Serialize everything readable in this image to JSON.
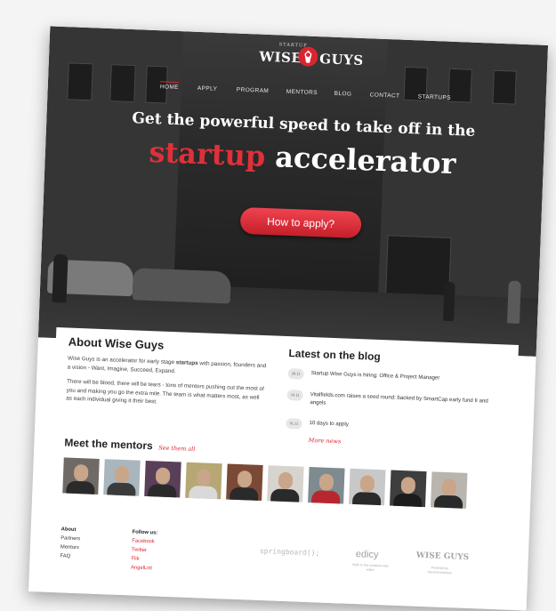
{
  "logo": {
    "small": "STARTUP",
    "left": "WISE",
    "right": "GUYS"
  },
  "nav": {
    "items": [
      "HOME",
      "APPLY",
      "PROGRAM",
      "MENTORS",
      "BLOG",
      "CONTACT",
      "STARTUPS"
    ],
    "active": "HOME"
  },
  "hero": {
    "headline": "Get the powerful speed to take off in the",
    "highlight": "startup",
    "rest": "accelerator",
    "cta": "How to apply?"
  },
  "about": {
    "title": "About Wise Guys",
    "p1_before": "Wise Guys is an accelerator for early stage ",
    "p1_bold": "startups",
    "p1_after": " with passion, founders and a vision - Want, Imagine, Succeed, Expand.",
    "p2": "There will be blood, there will be tears - tons of mentors pushing out the most of you and making you go the extra mile. The team is what matters most, as well as each individual giving it their best."
  },
  "blog": {
    "title": "Latest on the blog",
    "posts": [
      {
        "date": "28.11",
        "text": "Startup Wise Guys is hiring: Office & Project Manager"
      },
      {
        "date": "14.11",
        "text": "Vitalfields.com raises a seed round: backed by SmartCap early fund II and angels"
      },
      {
        "date": "01.11",
        "text": "10 days to apply"
      }
    ],
    "more": "More news"
  },
  "mentors": {
    "title": "Meet the mentors",
    "see_all": "See them all"
  },
  "footer": {
    "col1": {
      "title": "About",
      "links": [
        "Partners",
        "Mentors",
        "FAQ"
      ]
    },
    "col2": {
      "title": "Follow us:",
      "links": [
        "Facebook",
        "Twitter",
        "Flik",
        "AngelList"
      ]
    },
    "springboard": "springboard();",
    "edicy": "edicy",
    "edicy_sub": "Built on the smartest web editor",
    "wiseguys": "WISE GUYS",
    "wiseguys_sub": "Powered by #smartermarkets"
  },
  "colors": {
    "accent": "#d9252f"
  }
}
